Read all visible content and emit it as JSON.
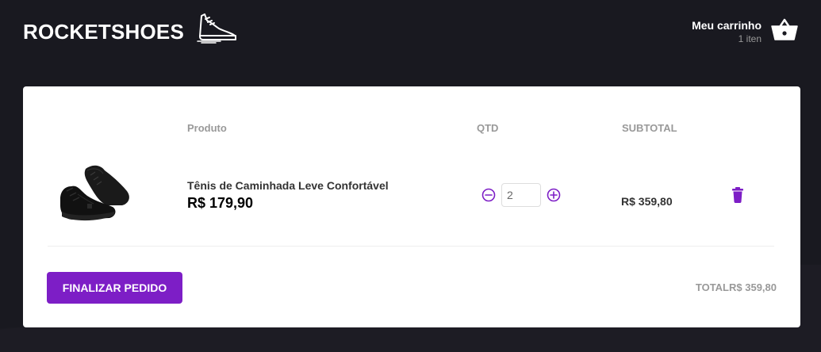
{
  "header": {
    "logo_text": "ROCKETSHOES",
    "cart": {
      "title": "Meu carrinho",
      "count": "1 iten"
    }
  },
  "table": {
    "headers": {
      "product": "Produto",
      "qty": "QTD",
      "subtotal": "SUBTOTAL"
    },
    "items": [
      {
        "name": "Tênis de Caminhada Leve Confortável",
        "price": "R$ 179,90",
        "quantity": "2",
        "subtotal": "R$ 359,80"
      }
    ]
  },
  "footer": {
    "checkout_label": "FINALIZAR PEDIDO",
    "total_label": "TOTAL",
    "total_value": "R$ 359,80"
  },
  "colors": {
    "background": "#191920",
    "accent": "#7d1ec6"
  },
  "icons": [
    "shoe-logo-icon",
    "basket-icon",
    "remove-circle-icon",
    "add-circle-icon",
    "trash-icon"
  ]
}
